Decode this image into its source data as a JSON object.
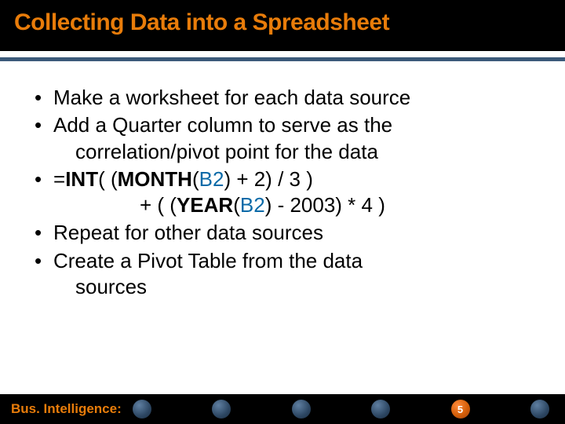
{
  "title": "Collecting Data into a Spreadsheet",
  "bullets": {
    "b1": "Make a worksheet for each data source",
    "b2": "Add a Quarter column to serve as the",
    "b2c": "correlation/pivot point for the data",
    "b3p1": "=",
    "b3fn1": "INT",
    "b3p2": "( (",
    "b3fn2": "MONTH",
    "b3p3": "(",
    "b3ref1": "B2",
    "b3p4": ") + 2) / 3 )",
    "b3c_p1": "+  ( (",
    "b3c_fn": "YEAR",
    "b3c_p2": "(",
    "b3c_ref": "B2",
    "b3c_p3": ") - 2003) * 4 )",
    "b4": "Repeat for other data sources",
    "b5": "Create a Pivot Table from the data",
    "b5c": "sources"
  },
  "footer": {
    "label": "Bus. Intelligence:",
    "page": "5"
  }
}
